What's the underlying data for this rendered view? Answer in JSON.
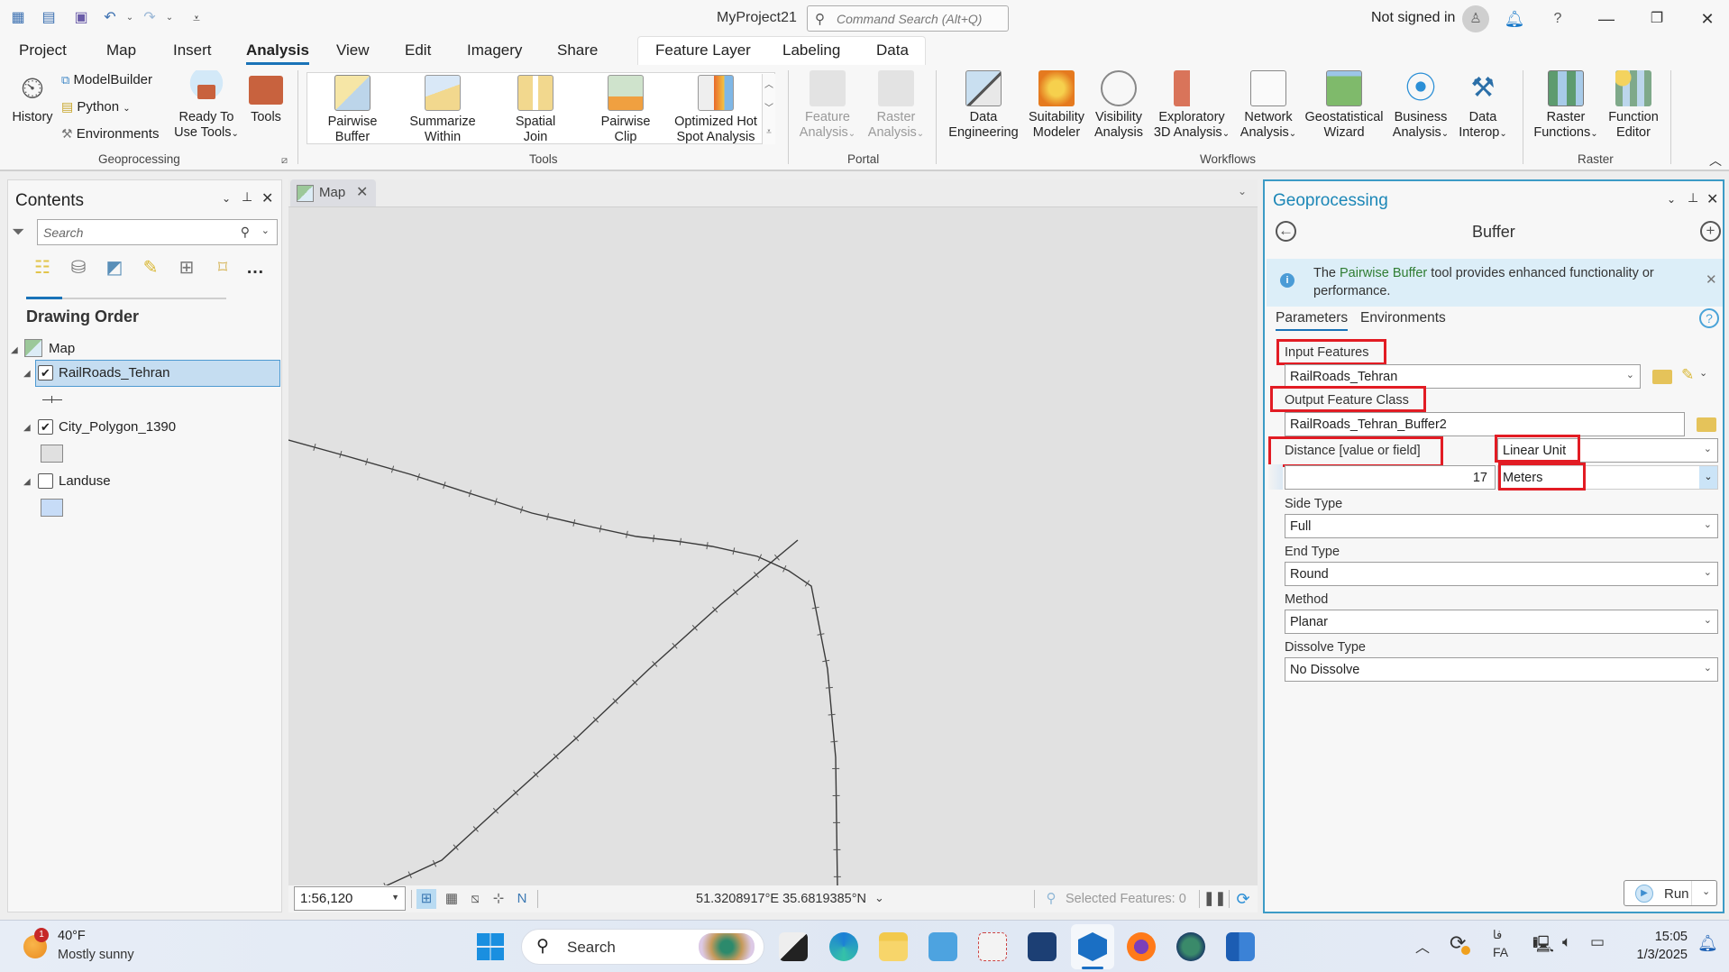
{
  "titlebar": {
    "project_name": "MyProject21",
    "command_search_placeholder": "Command Search (Alt+Q)",
    "signin_status": "Not signed in",
    "quick_access": [
      "new-project-icon",
      "open-project-icon",
      "save-project-icon",
      "undo-icon",
      "redo-icon",
      "customize-icon"
    ]
  },
  "ribbon_tabs": [
    "Project",
    "Map",
    "Insert",
    "Analysis",
    "View",
    "Edit",
    "Imagery",
    "Share"
  ],
  "ribbon_active_tab": "Analysis",
  "contextual_tabs": [
    "Feature Layer",
    "Labeling",
    "Data"
  ],
  "ribbon": {
    "geoprocessing": {
      "label": "Geoprocessing",
      "history": "History",
      "modelbuilder": "ModelBuilder",
      "python": "Python",
      "environments": "Environments",
      "ready_to_use_1": "Ready To",
      "ready_to_use_2": "Use Tools",
      "tools": "Tools"
    },
    "tools": {
      "label": "Tools",
      "items": [
        {
          "l1": "Pairwise",
          "l2": "Buffer"
        },
        {
          "l1": "Summarize",
          "l2": "Within"
        },
        {
          "l1": "Spatial",
          "l2": "Join"
        },
        {
          "l1": "Pairwise",
          "l2": "Clip"
        },
        {
          "l1": "Optimized Hot",
          "l2": "Spot Analysis"
        }
      ]
    },
    "portal": {
      "label": "Portal",
      "items": [
        {
          "l1": "Feature",
          "l2": "Analysis"
        },
        {
          "l1": "Raster",
          "l2": "Analysis"
        }
      ]
    },
    "workflows": {
      "label": "Workflows",
      "items": [
        {
          "l1": "Data",
          "l2": "Engineering"
        },
        {
          "l1": "Suitability",
          "l2": "Modeler"
        },
        {
          "l1": "Visibility",
          "l2": "Analysis"
        },
        {
          "l1": "Exploratory",
          "l2": "3D Analysis"
        },
        {
          "l1": "Network",
          "l2": "Analysis"
        },
        {
          "l1": "Geostatistical",
          "l2": "Wizard"
        },
        {
          "l1": "Business",
          "l2": "Analysis"
        },
        {
          "l1": "Data",
          "l2": "Interop"
        }
      ]
    },
    "raster": {
      "label": "Raster",
      "items": [
        {
          "l1": "Raster",
          "l2": "Functions"
        },
        {
          "l1": "Function",
          "l2": "Editor"
        }
      ]
    }
  },
  "contents": {
    "title": "Contents",
    "search_placeholder": "Search",
    "section_title": "Drawing Order",
    "map_name": "Map",
    "layers": [
      {
        "name": "RailRoads_Tehran",
        "checked": true,
        "selected": true,
        "swatch": "line"
      },
      {
        "name": "City_Polygon_1390",
        "checked": true,
        "selected": false,
        "swatch": "#e0e0e0"
      },
      {
        "name": "Landuse",
        "checked": false,
        "selected": false,
        "swatch": "#c7dcf7"
      }
    ]
  },
  "map": {
    "tab_label": "Map",
    "scale": "1:56,120",
    "coordinates": "51.3208917°E 35.6819385°N",
    "selected_features": "Selected Features: 0"
  },
  "geoprocessing": {
    "title": "Geoprocessing",
    "tool_name": "Buffer",
    "info_pre": "The ",
    "info_link": "Pairwise Buffer",
    "info_post": " tool provides enhanced functionality or performance.",
    "tabs": [
      "Parameters",
      "Environments"
    ],
    "params": {
      "input_features_label": "Input Features",
      "input_features_value": "RailRoads_Tehran",
      "output_label": "Output Feature Class",
      "output_value": "RailRoads_Tehran_Buffer2",
      "distance_label": "Distance [value or field]",
      "distance_type": "Linear Unit",
      "distance_value": "17",
      "distance_unit": "Meters",
      "side_type_label": "Side Type",
      "side_type_value": "Full",
      "end_type_label": "End Type",
      "end_type_value": "Round",
      "method_label": "Method",
      "method_value": "Planar",
      "dissolve_label": "Dissolve Type",
      "dissolve_value": "No Dissolve"
    },
    "run_label": "Run",
    "highlight_color": "#e21c24"
  },
  "taskbar": {
    "weather_temp": "40°F",
    "weather_desc": "Mostly sunny",
    "weather_badge": "1",
    "search_label": "Search",
    "lang_top": "فا",
    "lang_bottom": "FA",
    "time": "15:05",
    "date": "1/3/2025"
  }
}
